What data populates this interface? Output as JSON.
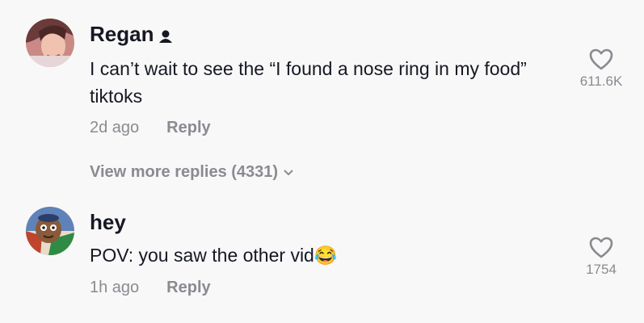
{
  "comments": [
    {
      "username": "Regan",
      "text": "I can’t wait to see the “I found a nose ring in my food” tiktoks",
      "time": "2d ago",
      "reply_label": "Reply",
      "likes": "611.6K",
      "badge_icon": "person-icon",
      "view_more_replies": "View more replies (4331)"
    },
    {
      "username": "hey",
      "text": "POV: you saw the other vid",
      "emoji": "😂",
      "time": "1h ago",
      "reply_label": "Reply",
      "likes": "1754"
    }
  ],
  "colors": {
    "background": "#f8f8f8",
    "text": "#161823",
    "muted": "#8a8b91"
  }
}
